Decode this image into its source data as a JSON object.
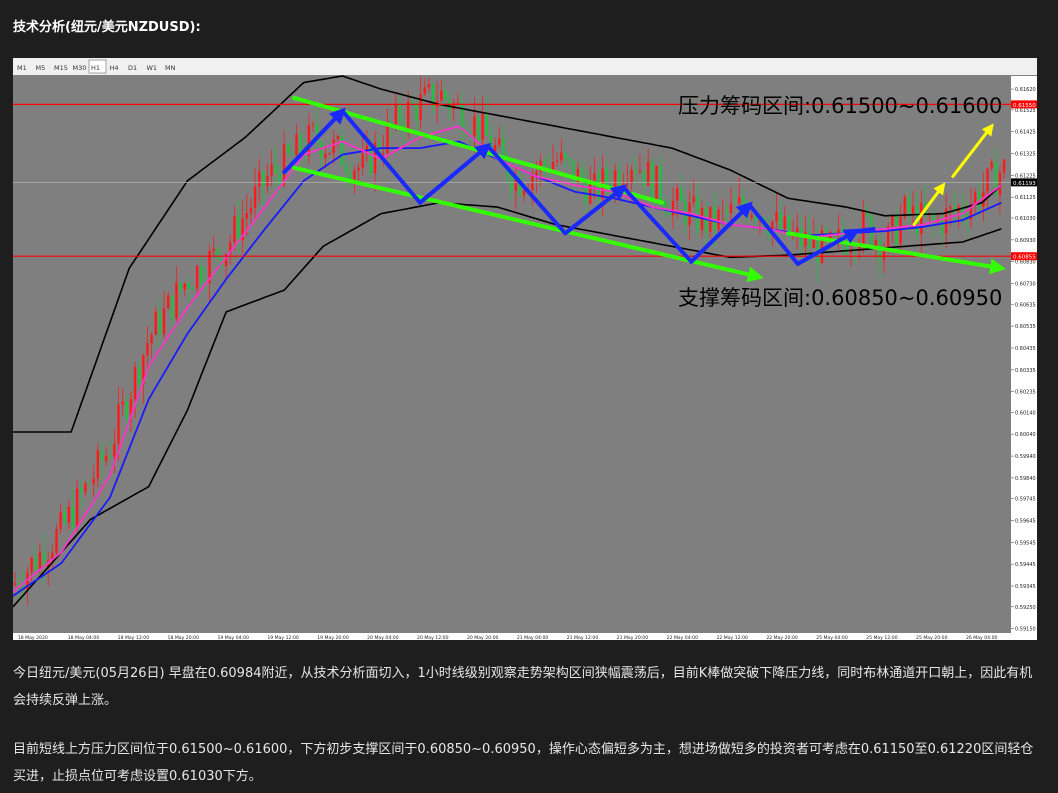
{
  "heading": "技术分析(纽元/美元NZDUSD):",
  "toolbar": {
    "timeframes": [
      "M1",
      "M5",
      "M15",
      "M30",
      "H1",
      "H4",
      "D1",
      "W1",
      "MN"
    ],
    "active": "H1"
  },
  "chart_data": {
    "type": "candlestick",
    "symbol": "NZDUSD",
    "timeframe": "H1",
    "ylim": [
      0.5913,
      0.6168
    ],
    "y_ticks": [
      "0.61620",
      "0.61525",
      "0.61425",
      "0.61325",
      "0.61225",
      "0.61125",
      "0.61030",
      "0.60930",
      "0.60830",
      "0.60730",
      "0.60635",
      "0.60535",
      "0.60435",
      "0.60335",
      "0.60235",
      "0.60140",
      "0.60040",
      "0.59940",
      "0.59840",
      "0.59745",
      "0.59645",
      "0.59545",
      "0.59445",
      "0.59345",
      "0.59250",
      "0.59150"
    ],
    "x_ticks": [
      "18 May 2020",
      "18 May 04:00",
      "18 May 12:00",
      "18 May 20:00",
      "19 May 04:00",
      "19 May 12:00",
      "19 May 20:00",
      "20 May 04:00",
      "20 May 12:00",
      "20 May 20:00",
      "21 May 04:00",
      "21 May 12:00",
      "21 May 20:00",
      "22 May 04:00",
      "22 May 12:00",
      "22 May 20:00",
      "25 May 04:00",
      "25 May 12:00",
      "25 May 20:00",
      "26 May 04:00"
    ],
    "resistance_line": 0.6155,
    "support_line": 0.60855,
    "current_price": 0.61193,
    "current_price_label": "0.61193",
    "resistance_tag": "0.61550",
    "support_tag": "0.60855",
    "annotations": {
      "resistance_zone": "压力筹码区间:0.61500~0.61600",
      "support_zone": "支撑筹码区间:0.60850~0.60950"
    },
    "colors": {
      "bull": "#ff1a1a",
      "bear": "#1fbf3f",
      "bands": "#000000",
      "ma_fast": "#ff33cc",
      "ma_slow": "#1a1aff",
      "channel": "#33ff00",
      "zigzag": "#1a2aff",
      "arrow_up": "#ffff00",
      "level": "#ff0000"
    },
    "price_path": [
      [
        0,
        0.5935
      ],
      [
        5,
        0.596
      ],
      [
        10,
        0.5998
      ],
      [
        14,
        0.6048
      ],
      [
        18,
        0.6075
      ],
      [
        22,
        0.609
      ],
      [
        26,
        0.612
      ],
      [
        31,
        0.614
      ],
      [
        33,
        0.6135
      ],
      [
        36,
        0.6125
      ],
      [
        40,
        0.615
      ],
      [
        44,
        0.616
      ],
      [
        48,
        0.6145
      ],
      [
        52,
        0.612
      ],
      [
        56,
        0.613
      ],
      [
        60,
        0.6115
      ],
      [
        64,
        0.613
      ],
      [
        68,
        0.611
      ],
      [
        72,
        0.61
      ],
      [
        76,
        0.611
      ],
      [
        80,
        0.6095
      ],
      [
        84,
        0.6088
      ],
      [
        88,
        0.61
      ],
      [
        90,
        0.609
      ],
      [
        92,
        0.6105
      ],
      [
        95,
        0.61
      ],
      [
        98,
        0.6108
      ],
      [
        100,
        0.6115
      ],
      [
        102,
        0.6125
      ]
    ],
    "bb_upper": [
      [
        0,
        0.6005
      ],
      [
        6,
        0.6005
      ],
      [
        12,
        0.608
      ],
      [
        18,
        0.612
      ],
      [
        24,
        0.614
      ],
      [
        30,
        0.6165
      ],
      [
        34,
        0.6168
      ],
      [
        38,
        0.6162
      ],
      [
        44,
        0.6155
      ],
      [
        50,
        0.615
      ],
      [
        56,
        0.6145
      ],
      [
        62,
        0.614
      ],
      [
        68,
        0.6135
      ],
      [
        74,
        0.6125
      ],
      [
        80,
        0.6112
      ],
      [
        86,
        0.6108
      ],
      [
        90,
        0.6104
      ],
      [
        96,
        0.6105
      ],
      [
        100,
        0.611
      ],
      [
        102,
        0.6118
      ]
    ],
    "bb_lower": [
      [
        0,
        0.5925
      ],
      [
        8,
        0.5965
      ],
      [
        14,
        0.598
      ],
      [
        18,
        0.6015
      ],
      [
        22,
        0.606
      ],
      [
        28,
        0.607
      ],
      [
        32,
        0.609
      ],
      [
        38,
        0.6105
      ],
      [
        44,
        0.611
      ],
      [
        50,
        0.6108
      ],
      [
        56,
        0.61
      ],
      [
        62,
        0.6095
      ],
      [
        68,
        0.609
      ],
      [
        74,
        0.6085
      ],
      [
        80,
        0.6086
      ],
      [
        86,
        0.6088
      ],
      [
        92,
        0.609
      ],
      [
        98,
        0.6092
      ],
      [
        102,
        0.6098
      ]
    ],
    "ma_fast": [
      [
        0,
        0.5932
      ],
      [
        5,
        0.595
      ],
      [
        10,
        0.5985
      ],
      [
        14,
        0.6035
      ],
      [
        18,
        0.6062
      ],
      [
        22,
        0.6085
      ],
      [
        26,
        0.6108
      ],
      [
        30,
        0.6132
      ],
      [
        34,
        0.6138
      ],
      [
        38,
        0.613
      ],
      [
        42,
        0.614
      ],
      [
        46,
        0.6145
      ],
      [
        50,
        0.613
      ],
      [
        54,
        0.6122
      ],
      [
        58,
        0.6118
      ],
      [
        62,
        0.6115
      ],
      [
        66,
        0.6108
      ],
      [
        70,
        0.6105
      ],
      [
        74,
        0.61
      ],
      [
        78,
        0.6098
      ],
      [
        82,
        0.6094
      ],
      [
        86,
        0.6096
      ],
      [
        90,
        0.6098
      ],
      [
        94,
        0.61
      ],
      [
        98,
        0.6105
      ],
      [
        102,
        0.6118
      ]
    ],
    "ma_slow": [
      [
        0,
        0.593
      ],
      [
        5,
        0.5945
      ],
      [
        10,
        0.5975
      ],
      [
        14,
        0.602
      ],
      [
        18,
        0.605
      ],
      [
        22,
        0.6075
      ],
      [
        26,
        0.6098
      ],
      [
        30,
        0.612
      ],
      [
        34,
        0.6132
      ],
      [
        38,
        0.6135
      ],
      [
        42,
        0.6135
      ],
      [
        46,
        0.6138
      ],
      [
        50,
        0.613
      ],
      [
        54,
        0.6122
      ],
      [
        58,
        0.6115
      ],
      [
        62,
        0.6112
      ],
      [
        66,
        0.6108
      ],
      [
        70,
        0.6104
      ],
      [
        74,
        0.61
      ],
      [
        78,
        0.6098
      ],
      [
        82,
        0.6095
      ],
      [
        86,
        0.6096
      ],
      [
        90,
        0.6097
      ],
      [
        94,
        0.6099
      ],
      [
        98,
        0.6102
      ],
      [
        102,
        0.611
      ]
    ],
    "channel_upper": [
      [
        29,
        0.6158
      ],
      [
        67,
        0.611
      ]
    ],
    "channel_upper_ext": [
      [
        80,
        0.6096
      ],
      [
        102,
        0.608
      ]
    ],
    "channel_lower": [
      [
        29,
        0.6126
      ],
      [
        77,
        0.6076
      ]
    ],
    "zigzag": [
      [
        28,
        0.6124
      ],
      [
        34,
        0.6152
      ],
      [
        42,
        0.611
      ],
      [
        49,
        0.6136
      ],
      [
        57,
        0.6096
      ],
      [
        63,
        0.6117
      ],
      [
        70,
        0.6083
      ],
      [
        76,
        0.6109
      ],
      [
        81,
        0.6082
      ],
      [
        87,
        0.6097
      ],
      [
        89,
        0.6098
      ]
    ],
    "zigzag_arrows": [
      [
        [
          28,
          0.6124
        ],
        [
          34,
          0.6152
        ]
      ],
      [
        [
          42,
          0.611
        ],
        [
          49,
          0.6136
        ]
      ],
      [
        [
          57,
          0.6096
        ],
        [
          63,
          0.6117
        ]
      ],
      [
        [
          70,
          0.6083
        ],
        [
          76,
          0.6109
        ]
      ],
      [
        [
          81,
          0.6082
        ],
        [
          87,
          0.6097
        ]
      ]
    ],
    "arrow_up_1": [
      [
        93,
        0.61
      ],
      [
        96,
        0.6118
      ]
    ],
    "arrow_up_2": [
      [
        97,
        0.6122
      ],
      [
        101,
        0.6145
      ]
    ]
  },
  "paragraphs": [
    "今日纽元/美元(05月26日) 早盘在0.60984附近，从技术分析面切入，1小时线级别观察走势架构区间狭幅震荡后，目前K棒做突破下降压力线，同时布林通道开口朝上，因此有机会持续反弹上涨。",
    "目前短线上方压力区间位于0.61500~0.61600，下方初步支撑区间于0.60850~0.60950，操作心态偏短多为主，想进场做短多的投资者可考虑在0.61150至0.61220区间轻仓买进，止损点位可考虑设置0.61030下方。"
  ]
}
